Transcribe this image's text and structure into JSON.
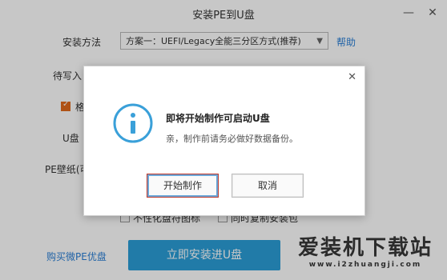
{
  "window": {
    "title": "安装PE到U盘"
  },
  "main": {
    "install_method_label": "安装方法",
    "install_method_value": "方案一：UEFI/Legacy全能三分区方式(推荐)",
    "help": "帮助",
    "pending_label": "待写入",
    "format_label": "格",
    "udisk_label": "U盘",
    "wallpaper_label": "PE壁纸(可",
    "personalize": "不性化盘符图标",
    "copy_package": "同时复制安装包",
    "buy_link": "购买微PE优盘",
    "install_button": "立即安装进U盘"
  },
  "dialog": {
    "title": "即将开始制作可启动U盘",
    "message": "亲，制作前请务必做好数据备份。",
    "start_button": "开始制作",
    "cancel_button": "取消"
  },
  "watermark": {
    "cn": "爱装机下载站",
    "en": "www.i2zhuangji.com"
  }
}
